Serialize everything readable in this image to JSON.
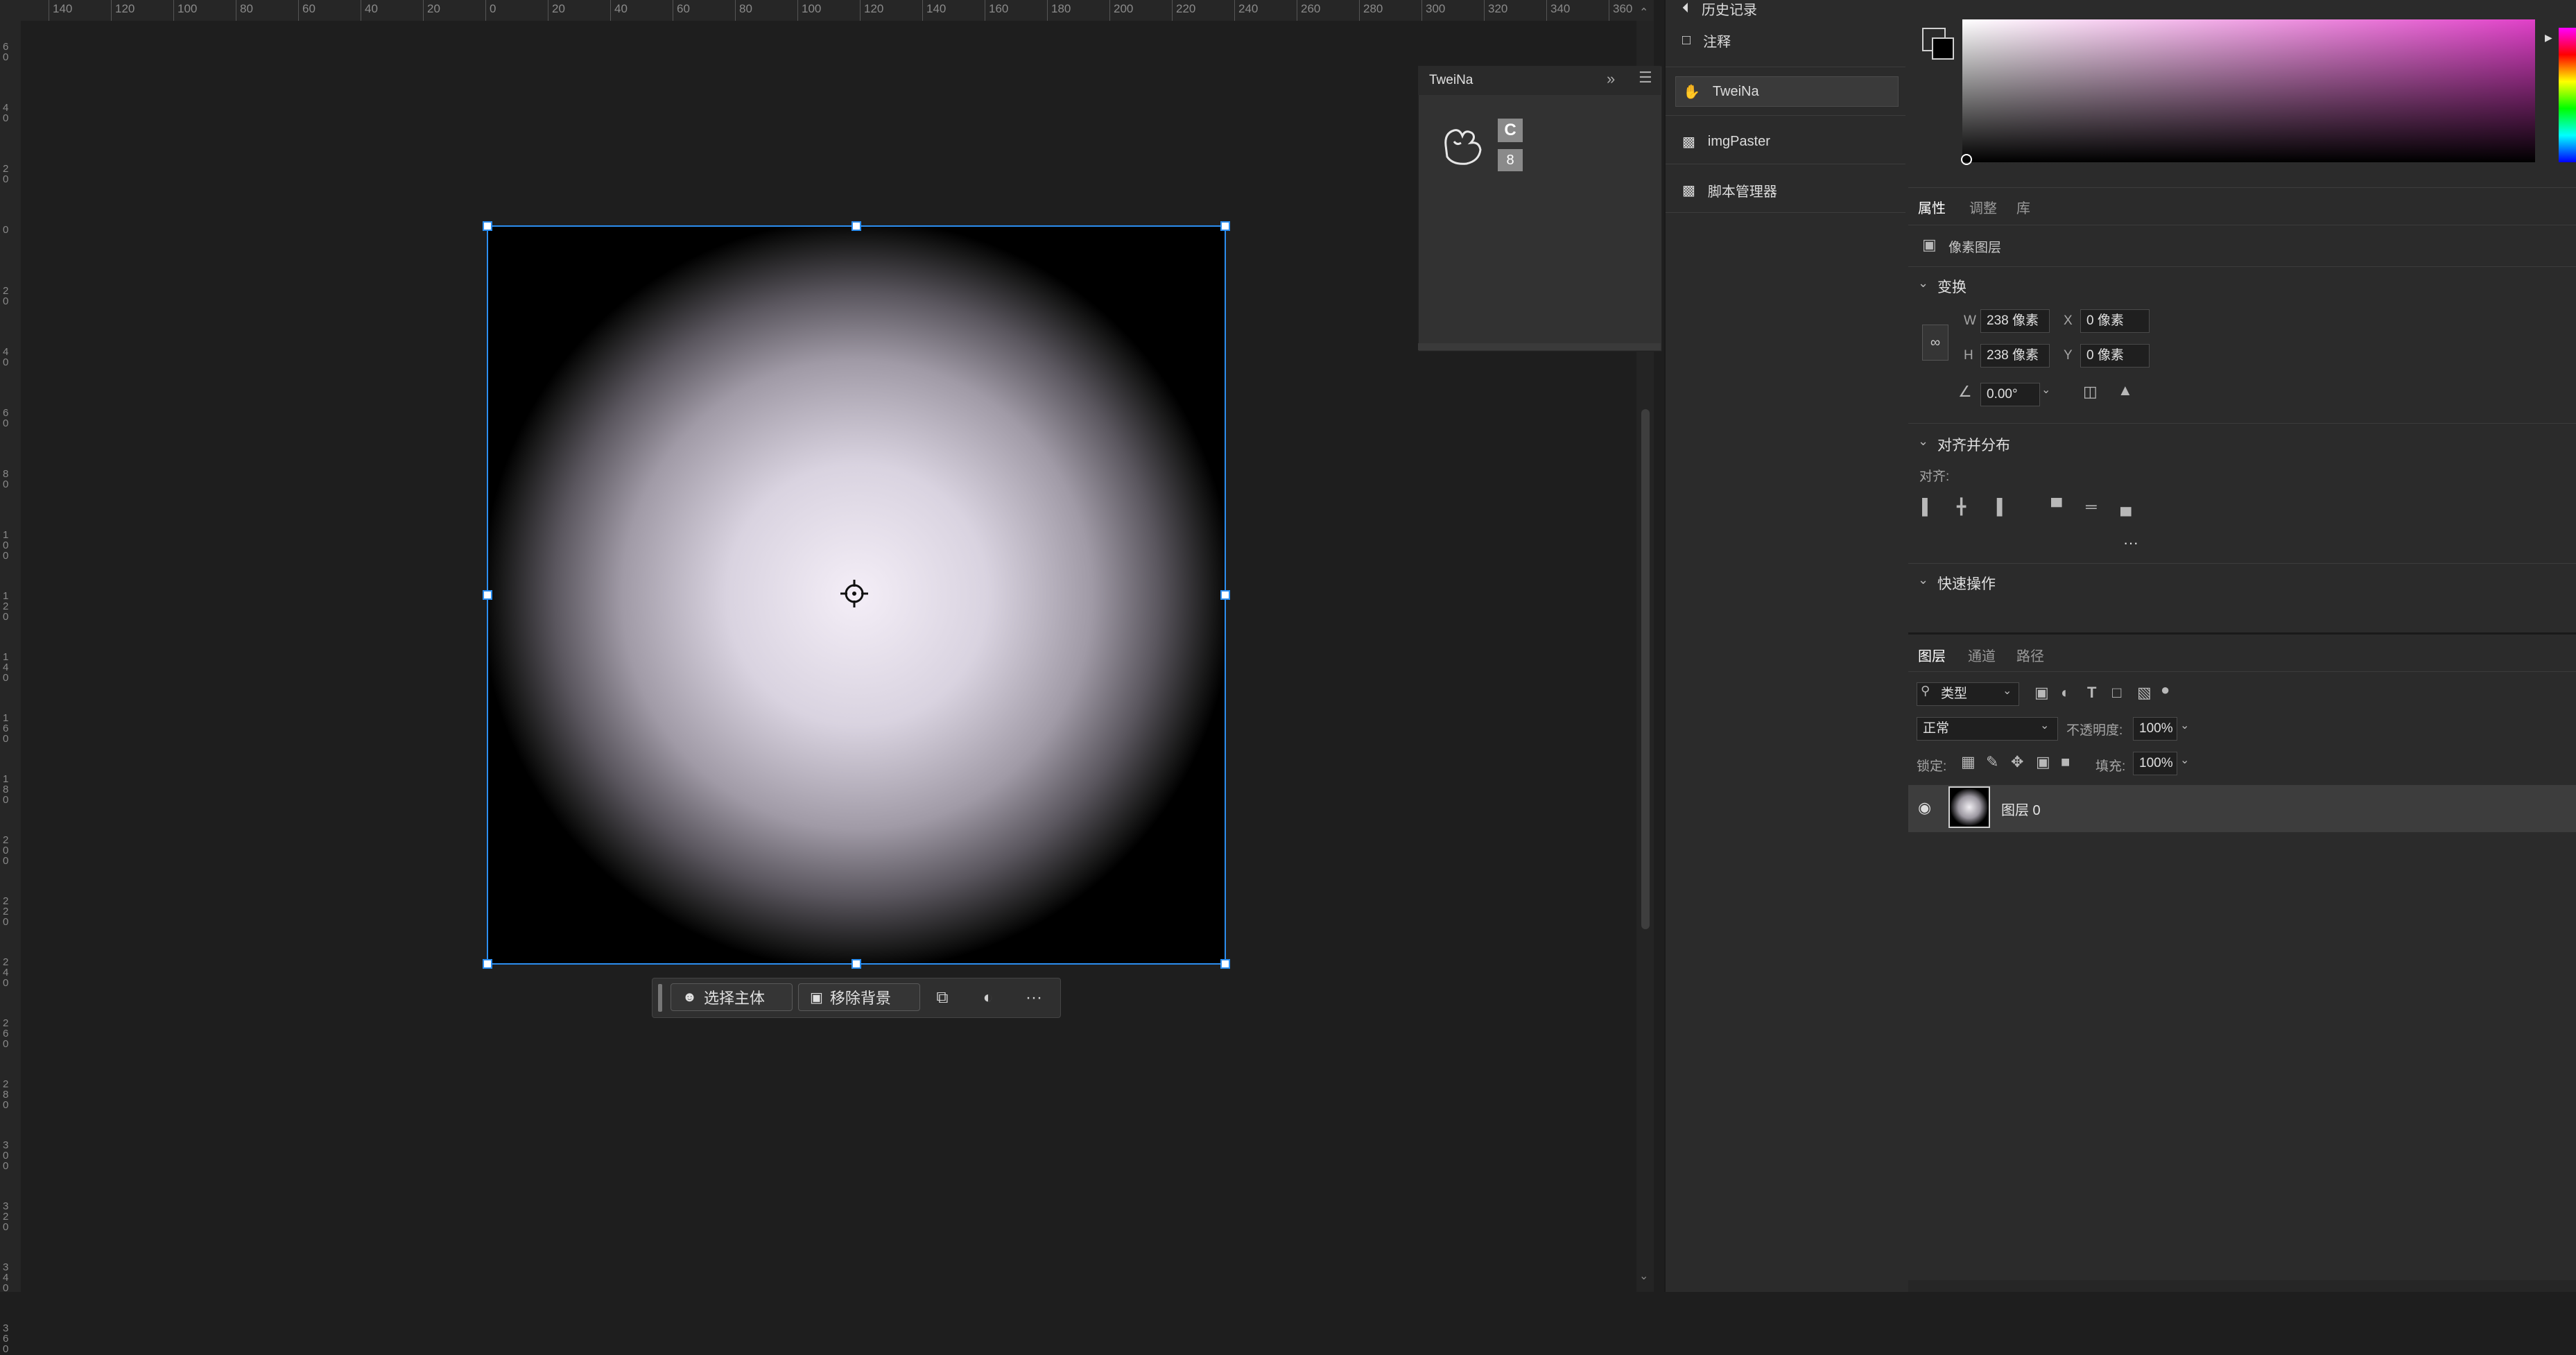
{
  "ruler_top": [
    "140",
    "120",
    "100",
    "80",
    "60",
    "40",
    "20",
    "0",
    "20",
    "40",
    "60",
    "80",
    "100",
    "120",
    "140",
    "160",
    "180",
    "200",
    "220",
    "240",
    "260",
    "280",
    "300",
    "320",
    "340",
    "360"
  ],
  "ruler_left": [
    "60",
    "40",
    "20",
    "0",
    "20",
    "40",
    "60",
    "80",
    "100",
    "120",
    "140",
    "160",
    "180",
    "200",
    "220",
    "240",
    "260",
    "280",
    "300",
    "320",
    "340",
    "360"
  ],
  "tweina_panel": {
    "title": "TweiNa",
    "btn_c": "C",
    "btn_link": "8"
  },
  "context_bar": {
    "select_subject": "选择主体",
    "remove_bg": "移除背景",
    "more": "···"
  },
  "middle_panel": {
    "items": [
      {
        "label": "历史记录",
        "icon": "history-icon"
      },
      {
        "label": "注释",
        "icon": "comment-icon"
      },
      {
        "label": "TweiNa",
        "icon": "hand-icon"
      },
      {
        "label": "imgPaster",
        "icon": "plugin-icon"
      },
      {
        "label": "脚本管理器",
        "icon": "plugin-icon"
      }
    ]
  },
  "properties": {
    "tabs": [
      "属性",
      "调整",
      "库"
    ],
    "layer_type": "像素图层",
    "transform_title": "变换",
    "w_label": "W",
    "w_value": "238 像素",
    "x_label": "X",
    "x_value": "0 像素",
    "h_label": "H",
    "h_value": "238 像素",
    "y_label": "Y",
    "y_value": "0 像素",
    "angle_value": "0.00°",
    "align_title": "对齐并分布",
    "align_label": "对齐:",
    "more": "···",
    "quick_title": "快速操作"
  },
  "layers": {
    "tabs": [
      "图层",
      "通道",
      "路径"
    ],
    "filter_label": "类型",
    "blend_mode": "正常",
    "opacity_label": "不透明度:",
    "opacity_value": "100%",
    "lock_label": "锁定:",
    "fill_label": "填充:",
    "fill_value": "100%",
    "layer_name": "图层 0"
  },
  "colors": {
    "accent": "#2c8ef0",
    "panel_bg": "#2b2b2b",
    "canvas_bg": "#1e1e1e"
  }
}
